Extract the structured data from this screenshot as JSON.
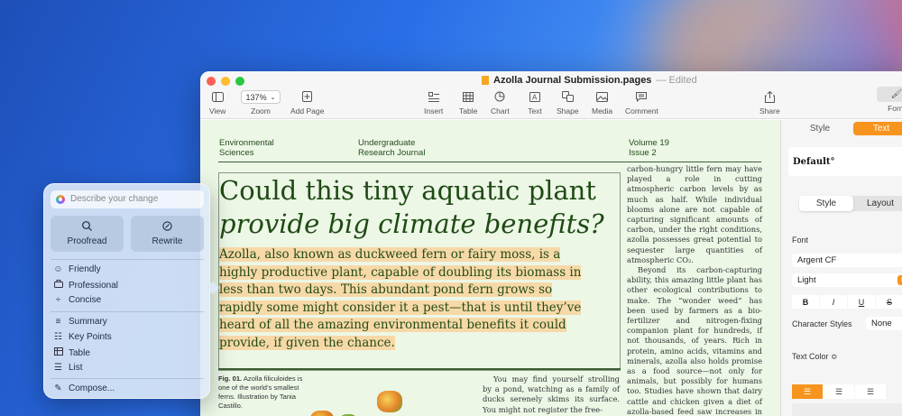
{
  "window": {
    "title": "Azolla Journal Submission.pages",
    "status": "— Edited",
    "traffic_colors": [
      "#ff5f57",
      "#febc2e",
      "#28c840"
    ]
  },
  "toolbar": {
    "view": "View",
    "zoom_value": "137%",
    "zoom": "Zoom",
    "add_page": "Add Page",
    "insert": "Insert",
    "table": "Table",
    "chart": "Chart",
    "text": "Text",
    "shape": "Shape",
    "media": "Media",
    "comment": "Comment",
    "share": "Share",
    "format": "Form"
  },
  "document": {
    "header_left_1": "Environmental",
    "header_left_2": "Sciences",
    "header_mid_1": "Undergraduate",
    "header_mid_2": "Research Journal",
    "header_right_1": "Volume 19",
    "header_right_2": "Issue 2",
    "headline_line1": "Could this tiny aquatic plant",
    "headline_line2": "provide big climate benefits?",
    "lede": "Azolla, also known as duckweed fern or fairy moss, is a highly productive plant, capable of doubling its biomass in less than two days. This abundant pond fern grows so rapidly some might consider it a pest—that is until they’ve heard of all the amazing environmental benefits it could provide, if given the chance.",
    "column_p1": "carbon-hungry little fern may have played a role in cutting atmospheric carbon levels by as much as half. While individual blooms alone are not capable of capturing significant amounts of carbon, under the right conditions, azolla possesses great potential to sequester large quantities of atmospheric CO₂.",
    "column_p2": "Beyond its carbon-capturing ability, this amazing little plant has other ecological contributions to make. The “wonder weed” has been used by farmers as a bio-fertilizer and nitrogen-fixing companion plant for hundreds, if not thousands, of years. Rich in protein, amino acids, vitamins and minerals, azolla also holds promise as a food source—not only for animals, but possibly for humans too. Studies have shown that dairy cattle and chicken given a diet of azolla-based feed saw increases in their production of",
    "caption_label": "Fig. 01.",
    "caption_text": " Azolla filiculoides is one of the world’s smallest ferns. Illustration by Tania Castillo.",
    "column2": "You may find yourself strolling by a pond, watching as a family of ducks serenely skims its surface. You might not register the free-"
  },
  "inspector": {
    "tab_style": "Style",
    "tab_text": "Text",
    "paragraph_style": "Default°",
    "seg_style": "Style",
    "seg_layout": "Layout",
    "font_label": "Font",
    "font_family": "Argent CF",
    "font_weight": "Light",
    "bold": "B",
    "italic": "I",
    "underline": "U",
    "strike": "S",
    "char_styles_label": "Character Styles",
    "char_styles_value": "None",
    "text_color_label": "Text Color ≎",
    "accent": "#f7941d"
  },
  "writing_tools": {
    "placeholder": "Describe your change",
    "proofread": "Proofread",
    "rewrite": "Rewrite",
    "friendly": "Friendly",
    "professional": "Professional",
    "concise": "Concise",
    "summary": "Summary",
    "key_points": "Key Points",
    "table": "Table",
    "list": "List",
    "compose": "Compose..."
  }
}
